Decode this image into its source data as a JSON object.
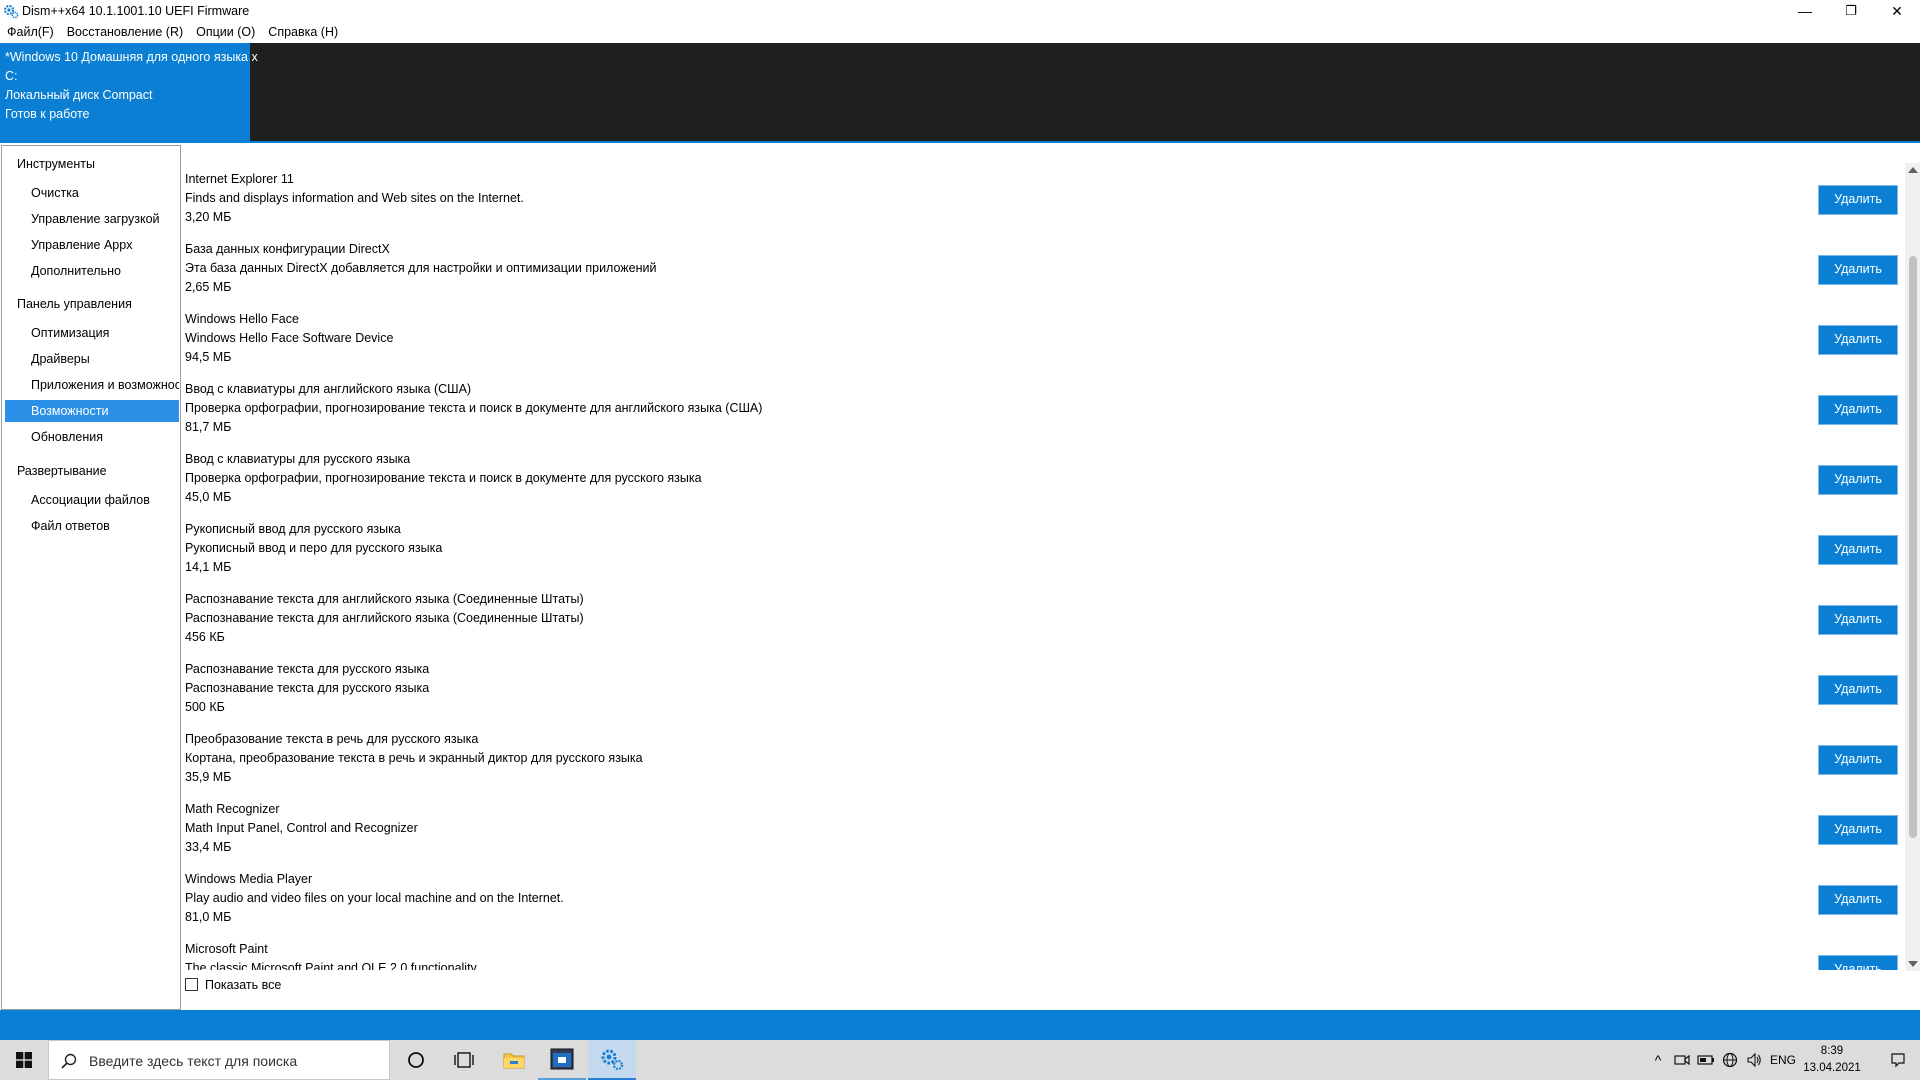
{
  "window": {
    "title": "Dism++x64 10.1.1001.10 UEFI Firmware",
    "minimize": "—",
    "maximize": "❐",
    "close": "✕"
  },
  "menu": [
    "Файл(F)",
    "Восстановление (R)",
    "Опции (O)",
    "Справка (H)"
  ],
  "session": {
    "image_name": "*Windows 10 Домашняя для одного языка x",
    "drive": "C:",
    "disk": "Локальный диск Compact",
    "status": "Готов к работе"
  },
  "sidebar": {
    "groups": [
      {
        "label": "Инструменты",
        "items": [
          "Очистка",
          "Управление загрузкой",
          "Управление Appx",
          "Дополнительно"
        ]
      },
      {
        "label": "Панель управления",
        "items": [
          "Оптимизация",
          "Драйверы",
          "Приложения и возможнос",
          "Возможности",
          "Обновления"
        ]
      },
      {
        "label": "Развертывание",
        "items": [
          "Ассоциации файлов",
          "Файл ответов"
        ]
      }
    ],
    "active": "Возможности"
  },
  "features": [
    {
      "name": "Internet Explorer 11",
      "desc": "Finds and displays information and Web sites on the Internet.",
      "size": "3,20 МБ"
    },
    {
      "name": "База данных конфигурации DirectX",
      "desc": "Эта база данных DirectX добавляется для настройки и оптимизации приложений",
      "size": "2,65 МБ"
    },
    {
      "name": "Windows Hello Face",
      "desc": "Windows Hello Face Software Device",
      "size": "94,5 МБ"
    },
    {
      "name": "Ввод с клавиатуры для английского языка (США)",
      "desc": "Проверка орфографии, прогнозирование текста и поиск в документе для английского языка (США)",
      "size": "81,7 МБ"
    },
    {
      "name": "Ввод с клавиатуры для русского языка",
      "desc": "Проверка орфографии, прогнозирование текста и поиск в документе для русского языка",
      "size": "45,0 МБ"
    },
    {
      "name": "Рукописный ввод для русского языка",
      "desc": "Рукописный ввод и перо для русского языка",
      "size": "14,1 МБ"
    },
    {
      "name": "Распознавание текста для английского языка (Соединенные Штаты)",
      "desc": "Распознавание текста для английского языка (Соединенные Штаты)",
      "size": "456 КБ"
    },
    {
      "name": "Распознавание текста для русского языка",
      "desc": "Распознавание текста для русского языка",
      "size": "500 КБ"
    },
    {
      "name": "Преобразование текста в речь для русского языка",
      "desc": "Кортана, преобразование текста в речь и экранный диктор для русского языка",
      "size": "35,9 МБ"
    },
    {
      "name": "Math Recognizer",
      "desc": "Math Input Panel, Control and Recognizer",
      "size": "33,4 МБ"
    },
    {
      "name": "Windows Media Player",
      "desc": "Play audio and video files on your local machine and on the Internet.",
      "size": "81,0 МБ"
    },
    {
      "name": "Microsoft Paint",
      "desc": "The classic Microsoft Paint and OLE 2.0 functionality",
      "size": ""
    }
  ],
  "delete_label": "Удалить",
  "show_all_label": "Показать все",
  "taskbar": {
    "search_placeholder": "Введите здесь текст для поиска",
    "tray_chevron": "^",
    "language": "ENG",
    "time": "8:39",
    "date": "13.04.2021"
  },
  "colors": {
    "accent": "#0a7fd4",
    "header_dark": "#1f1f1f",
    "sidebar_active": "#2b90e8"
  },
  "icons": [
    "gear-icon",
    "windows-start-icon",
    "search-icon",
    "cortana-icon",
    "task-view-icon",
    "file-explorer-icon",
    "dism-icon",
    "tray-chevron-icon",
    "meet-now-icon",
    "battery-icon",
    "network-icon",
    "volume-icon",
    "notification-icon"
  ]
}
